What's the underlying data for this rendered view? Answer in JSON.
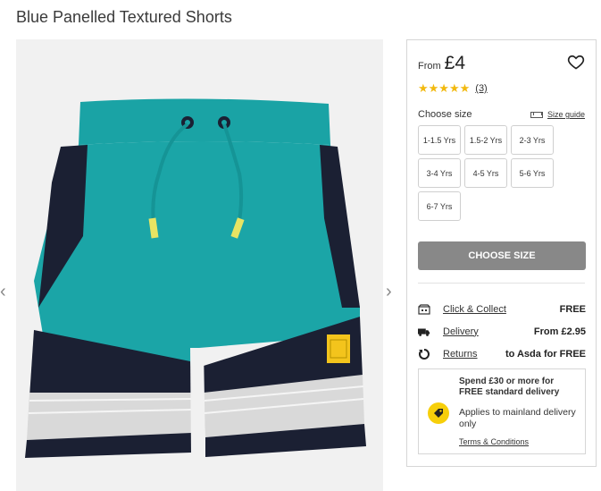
{
  "product": {
    "title": "Blue Panelled Textured Shorts"
  },
  "gallery": {
    "prev_arrow": "‹",
    "next_arrow": "›"
  },
  "price": {
    "from_label": "From",
    "value": "£4"
  },
  "rating": {
    "stars": "★★★★★",
    "count": "(3)"
  },
  "size": {
    "title": "Choose size",
    "guide_label": "Size guide",
    "options": [
      "1-1.5 Yrs",
      "1.5-2 Yrs",
      "2-3 Yrs",
      "3-4 Yrs",
      "4-5 Yrs",
      "5-6 Yrs",
      "6-7 Yrs"
    ],
    "button_label": "CHOOSE SIZE"
  },
  "delivery": {
    "rows": [
      {
        "label": "Click & Collect",
        "value": "FREE",
        "icon": "store-icon"
      },
      {
        "label": "Delivery",
        "value": "From £2.95",
        "icon": "truck-icon"
      },
      {
        "label": "Returns",
        "value": "to Asda for FREE",
        "icon": "return-icon"
      }
    ]
  },
  "promo": {
    "headline": "Spend £30 or more for FREE standard delivery",
    "text": "Applies to mainland delivery only",
    "link": "Terms & Conditions"
  },
  "colors": {
    "shorts_teal": "#1aa3a5",
    "shorts_navy": "#1b2033",
    "shorts_grey": "#d9d9d9",
    "button_grey": "#888888",
    "star_yellow": "#f2b90f",
    "promo_yellow": "#f7cf0a"
  }
}
